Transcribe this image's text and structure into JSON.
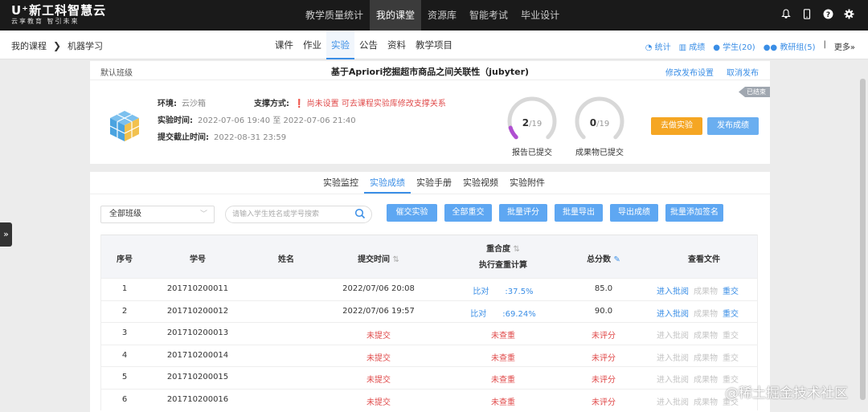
{
  "topbar": {
    "logo_main": "U⁺新工科智慧云",
    "logo_sub": "云享教育 智引未来",
    "nav": [
      "教学质量统计",
      "我的课堂",
      "资源库",
      "智能考试",
      "毕业设计"
    ],
    "active_nav": 1
  },
  "subbar": {
    "breadcrumb": [
      "我的课程",
      "机器学习"
    ],
    "tabs": [
      "课件",
      "作业",
      "实验",
      "公告",
      "资料",
      "教学项目"
    ],
    "active_tab": 2,
    "right_links": [
      "统计",
      "成绩",
      "学生(20)",
      "教研组(5)",
      "更多»"
    ]
  },
  "experiment": {
    "class_name": "默认班级",
    "title": "基于Apriori挖掘超市商品之间关联性（jubyter)",
    "links": [
      "修改发布设置",
      "取消发布"
    ],
    "status_tag": "已结束",
    "env_label": "环境:",
    "env_value": "云沙箱",
    "support_label": "支撑方式:",
    "support_value": "尚未设置 可去课程实验库修改支撑关系",
    "time_label": "实验时间:",
    "time_start": "2022-07-06 19:40",
    "time_to": "至",
    "time_end": "2022-07-06 21:40",
    "deadline_label": "提交截止时间:",
    "deadline_value": "2022-08-31 23:59",
    "gauge1": {
      "done": "2",
      "total": "/19",
      "label": "报告已提交",
      "fraction": 0.105
    },
    "gauge2": {
      "done": "0",
      "total": "/19",
      "label": "成果物已提交",
      "fraction": 0
    },
    "btn_go": "去做实验",
    "btn_publish": "发布成绩",
    "btn_go_color": "#f5a623",
    "btn_publish_color": "#6aaef0"
  },
  "results": {
    "tabs": [
      "实验监控",
      "实验成绩",
      "实验手册",
      "实验视频",
      "实验附件"
    ],
    "active_tab": 1,
    "class_select": "全部班级",
    "search_placeholder": "请输入学生姓名或学号搜索",
    "buttons": [
      "催交实验",
      "全部重交",
      "批量评分",
      "批量导出",
      "导出成绩",
      "批量添加签名"
    ],
    "columns": {
      "index": "序号",
      "id": "学号",
      "name": "姓名",
      "submit_time": "提交时间",
      "similarity": "重合度",
      "similarity_action": "执行查重计算",
      "score": "总分数",
      "files": "查看文件"
    },
    "rows": [
      {
        "index": "1",
        "id": "201710200011",
        "name": "",
        "time": "2022/07/06 20:08",
        "similarity": "比对",
        "similarity_pct": ":37.5%",
        "score": "85.0",
        "actions": [
          "进入批阅",
          "成果物",
          "重交"
        ],
        "submitted": true
      },
      {
        "index": "2",
        "id": "201710200012",
        "name": "",
        "time": "2022/07/06 19:57",
        "similarity": "比对",
        "similarity_pct": ":69.24%",
        "score": "90.0",
        "actions": [
          "进入批阅",
          "成果物",
          "重交"
        ],
        "submitted": true
      },
      {
        "index": "3",
        "id": "201710200013",
        "name": "",
        "time": "未提交",
        "similarity": "未查重",
        "similarity_pct": "",
        "score": "未评分",
        "actions": [
          "进入批阅",
          "成果物",
          "重交"
        ],
        "submitted": false
      },
      {
        "index": "4",
        "id": "201710200014",
        "name": "",
        "time": "未提交",
        "similarity": "未查重",
        "similarity_pct": "",
        "score": "未评分",
        "actions": [
          "进入批阅",
          "成果物",
          "重交"
        ],
        "submitted": false
      },
      {
        "index": "5",
        "id": "201710200015",
        "name": "",
        "time": "未提交",
        "similarity": "未查重",
        "similarity_pct": "",
        "score": "未评分",
        "actions": [
          "进入批阅",
          "成果物",
          "重交"
        ],
        "submitted": false
      },
      {
        "index": "6",
        "id": "201710200016",
        "name": "",
        "time": "未提交",
        "similarity": "未查重",
        "similarity_pct": "",
        "score": "未评分",
        "actions": [
          "进入批阅",
          "成果物",
          "重交"
        ],
        "submitted": false
      }
    ]
  },
  "watermark": "@稀土掘金技术社区",
  "side_handle": "»"
}
